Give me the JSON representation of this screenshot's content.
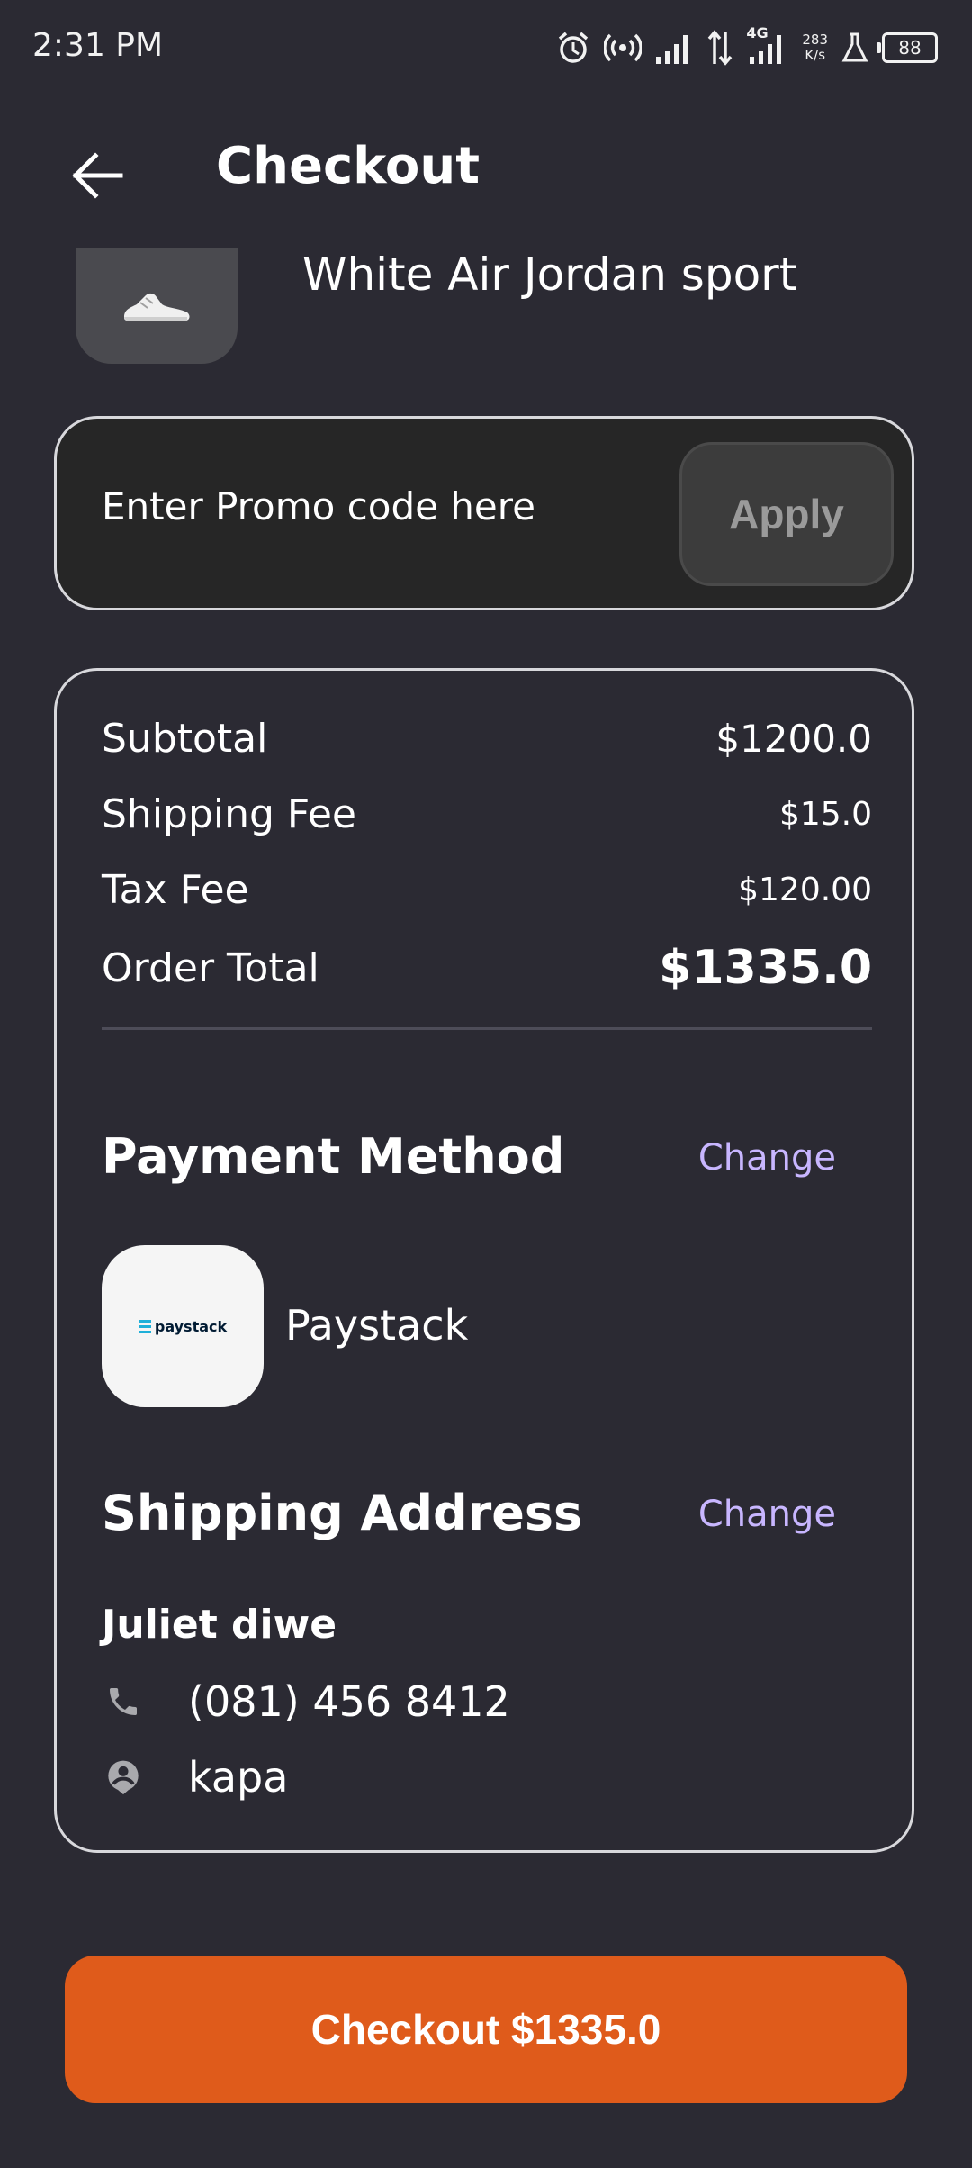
{
  "status_bar": {
    "time": "2:31 PM",
    "network_type": "4G",
    "speed_value": "283",
    "speed_unit": "K/s",
    "battery": "88"
  },
  "header": {
    "title": "Checkout",
    "back_icon": "arrow-left-icon"
  },
  "product": {
    "name": "White Air Jordan sport"
  },
  "promo": {
    "placeholder": "Enter Promo code here",
    "value": "",
    "apply_label": "Apply"
  },
  "summary": {
    "rows": [
      {
        "label": "Subtotal",
        "value": "$1200.0"
      },
      {
        "label": "Shipping Fee",
        "value": "$15.0"
      },
      {
        "label": "Tax Fee",
        "value": "$120.00"
      },
      {
        "label": "Order Total",
        "value": "$1335.0"
      }
    ]
  },
  "payment": {
    "title": "Payment Method",
    "change_label": "Change",
    "logo_text": "paystack",
    "method_name": "Paystack"
  },
  "shipping": {
    "title": "Shipping Address",
    "change_label": "Change",
    "name": "Juliet diwe",
    "phone": "(081) 456 8412",
    "location": "kapa",
    "phone_icon": "phone-icon",
    "location_icon": "person-pin-icon"
  },
  "checkout": {
    "label": "Checkout $1335.0"
  },
  "colors": {
    "background": "#2b2a33",
    "accent": "#df5b1b",
    "link": "#c8b6ff"
  }
}
